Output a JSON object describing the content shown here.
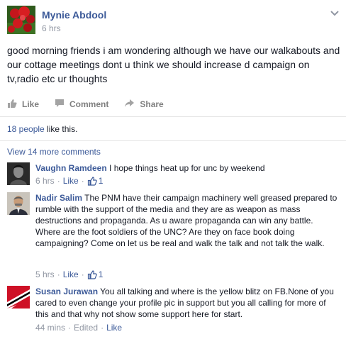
{
  "post": {
    "author": "Mynie Abdool",
    "time": "6 hrs",
    "text": "good morning friends i am wondering although we have our walkabouts and our cottage meetings dont u think we should increase d campaign on tv,radio etc ur thoughts"
  },
  "actions": {
    "like": "Like",
    "comment": "Comment",
    "share": "Share"
  },
  "likes": {
    "people": "18 people",
    "suffix": " like this."
  },
  "view_more": "View 14 more comments",
  "comments": [
    {
      "name": "Vaughn Ramdeen",
      "text": "I hope things heat up for unc by weekend",
      "time": "6 hrs",
      "like": "Like",
      "likes": "1"
    },
    {
      "name": "Nadir Salim",
      "text": "The PNM have their campaign machinery well greased prepared to rumble with the support of the media and they are as weapon as mass destructions and propaganda. As u aware propaganda can win any battle. Where are the foot soldiers of the UNC? Are they on face book doing campaigning? Come on let us be real and walk the talk and not talk the walk.",
      "time": "5 hrs",
      "like": "Like",
      "likes": "1"
    },
    {
      "name": "Susan Jurawan",
      "text": "You all talking and where is the yellow blitz on FB.None of you cared to even change your profile pic in support but you all calling for more of this and that why not show some support here for start.",
      "time": "44 mins",
      "edited": "Edited",
      "like": "Like"
    }
  ],
  "colors": {
    "link": "#3b5998",
    "meta": "#9197a3",
    "action": "#7f7f7f"
  },
  "icons": {
    "menu": "chevron-down-icon",
    "like": "thumbs-up-icon",
    "comment": "speech-bubble-icon",
    "share": "share-arrow-icon",
    "comment_like": "thumbs-up-outline-icon"
  }
}
